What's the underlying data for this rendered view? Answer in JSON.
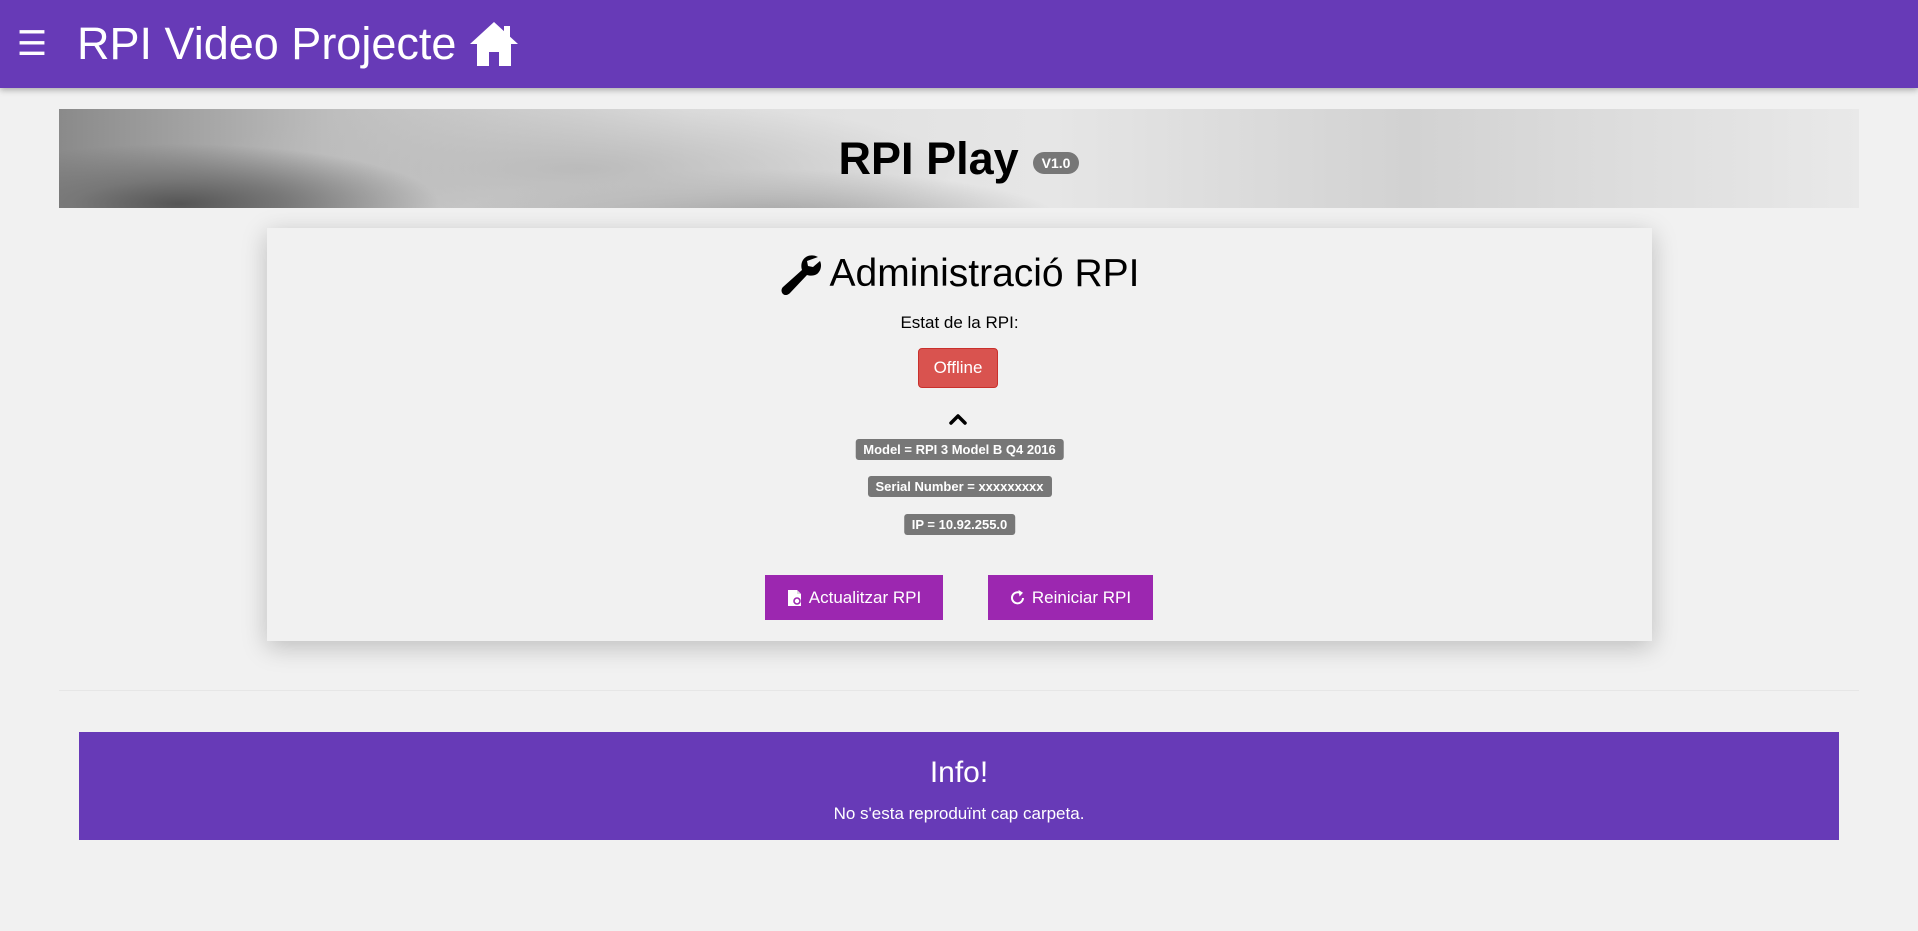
{
  "header": {
    "menu_glyph": "☰",
    "title": "RPI Video Projecte",
    "menu_icon": "hamburger-menu-icon",
    "home_icon": "home-icon",
    "background_color": "#673ab7"
  },
  "banner": {
    "title": "RPI Play",
    "version": "V1.0"
  },
  "admin": {
    "heading": "Administració RPI",
    "heading_icon": "wrench-icon",
    "status_label": "Estat de la RPI:",
    "status_value": "Offline",
    "status_color": "#d9534f",
    "details_toggle_icon": "chevron-up-icon",
    "details": {
      "model": "Model = RPI 3 Model B Q4 2016",
      "serial": "Serial Number = xxxxxxxxx",
      "ip": "IP = 10.92.255.0"
    },
    "update_button": "Actualitzar RPI",
    "update_icon": "file-update-icon",
    "restart_button": "Reiniciar RPI",
    "restart_icon": "refresh-icon",
    "button_color": "#9c27b0"
  },
  "info": {
    "title": "Info!",
    "text": "No s'esta reproduïnt cap carpeta.",
    "background_color": "#673ab7"
  }
}
